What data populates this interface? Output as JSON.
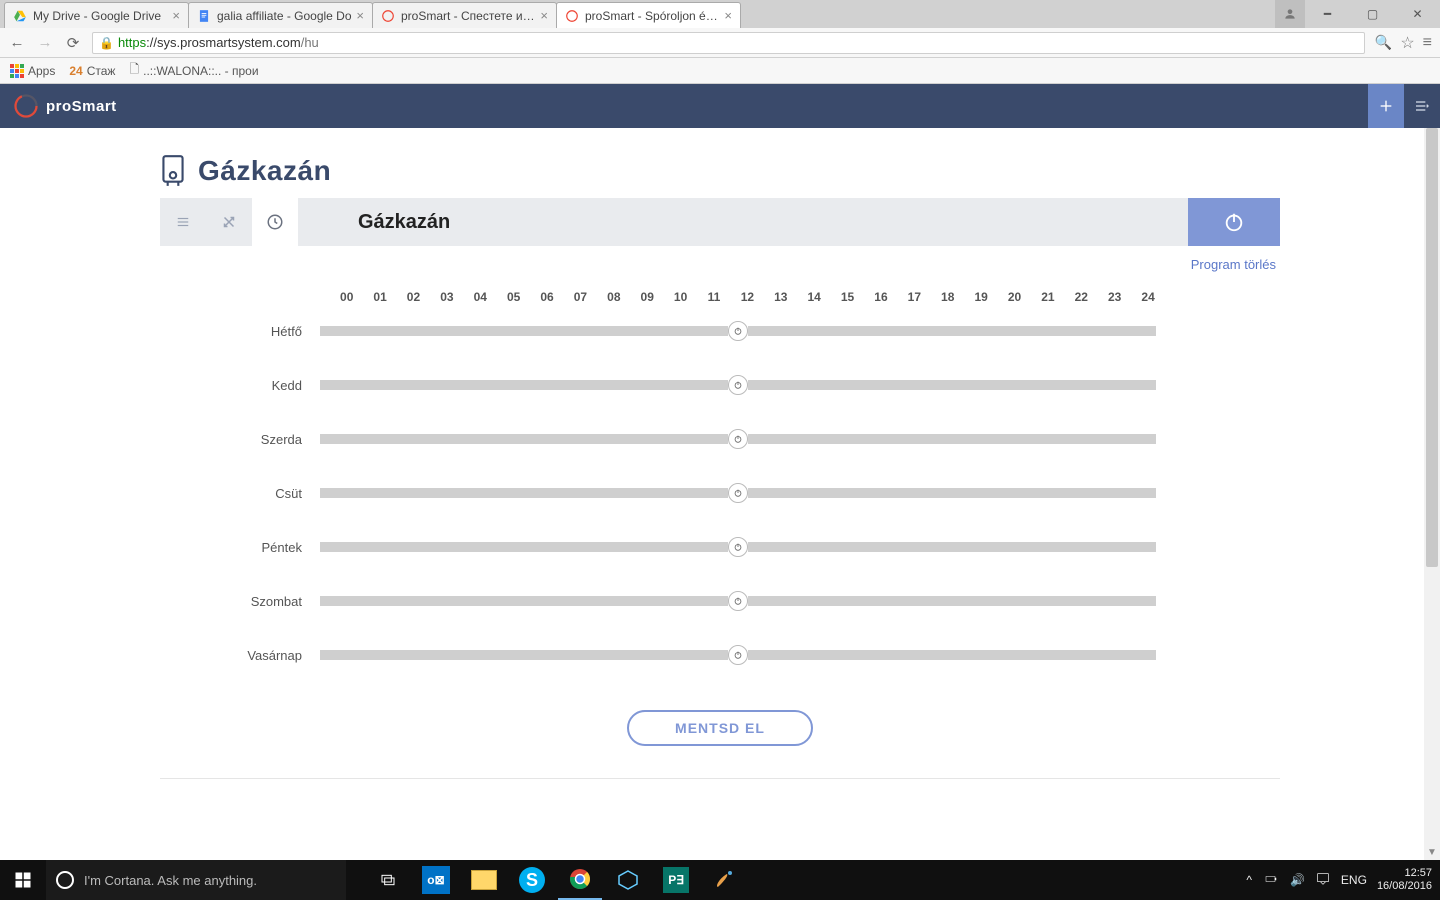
{
  "browser": {
    "tabs": [
      {
        "title": "My Drive - Google Drive"
      },
      {
        "title": "galia affiliate - Google Do"
      },
      {
        "title": "proSmart - Спестете и уп"
      },
      {
        "title": "proSmart - Spóroljon és v"
      }
    ],
    "url_scheme": "https",
    "url_host": "://sys.prosmartsystem.com",
    "url_path": "/hu",
    "bookmarks": {
      "apps": "Apps",
      "b1": "24",
      "b1b": "Стаж",
      "b2": "..::WALONA::.. - прои"
    }
  },
  "app": {
    "name": "proSmart"
  },
  "page": {
    "title": "Gázkazán",
    "device_name": "Gázkazán",
    "delete_link": "Program törlés",
    "save": "MENTSD EL"
  },
  "schedule": {
    "hours": [
      "00",
      "01",
      "02",
      "03",
      "04",
      "05",
      "06",
      "07",
      "08",
      "09",
      "10",
      "11",
      "12",
      "13",
      "14",
      "15",
      "16",
      "17",
      "18",
      "19",
      "20",
      "21",
      "22",
      "23",
      "24"
    ],
    "days": [
      "Hétfő",
      "Kedd",
      "Szerda",
      "Csüt",
      "Péntek",
      "Szombat",
      "Vasárnap"
    ],
    "marker_hour": 12
  },
  "taskbar": {
    "search_placeholder": "I'm Cortana. Ask me anything.",
    "lang": "ENG",
    "time": "12:57",
    "date": "16/08/2016"
  }
}
